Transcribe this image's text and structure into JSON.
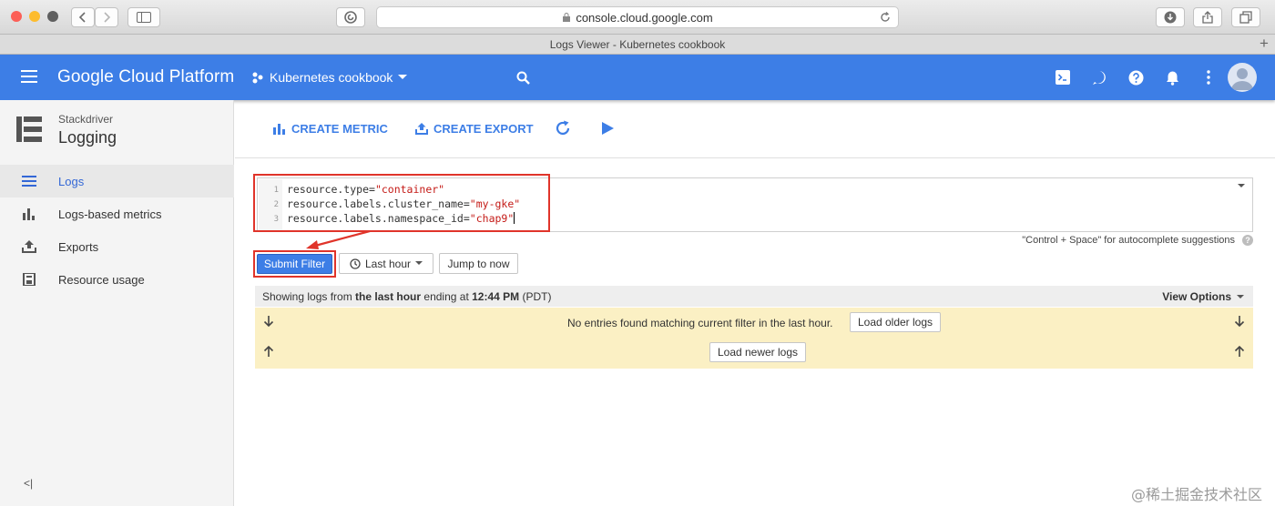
{
  "browser": {
    "url": "console.cloud.google.com",
    "tab_title": "Logs Viewer - Kubernetes cookbook",
    "new_tab": "+"
  },
  "header": {
    "brand": "Google Cloud Platform",
    "project": "Kubernetes cookbook",
    "accent": "#3d7ee6"
  },
  "sidebar": {
    "product_small": "Stackdriver",
    "product_big": "Logging",
    "items": [
      {
        "label": "Logs",
        "icon": "list-icon",
        "active": true
      },
      {
        "label": "Logs-based metrics",
        "icon": "bar-chart-icon"
      },
      {
        "label": "Exports",
        "icon": "upload-icon"
      },
      {
        "label": "Resource usage",
        "icon": "storage-icon"
      }
    ],
    "collapse": "<|"
  },
  "actions": {
    "create_metric": "CREATE METRIC",
    "create_export": "CREATE EXPORT"
  },
  "filter": {
    "lines": [
      {
        "num": "1",
        "key": "resource.type=",
        "value": "\"container\""
      },
      {
        "num": "2",
        "key": "resource.labels.cluster_name=",
        "value": "\"my-gke\""
      },
      {
        "num": "3",
        "key": "resource.labels.namespace_id=",
        "value": "\"chap9\""
      }
    ],
    "hint": "\"Control + Space\" for autocomplete suggestions",
    "help": "?"
  },
  "controls": {
    "submit": "Submit Filter",
    "time_range": "Last hour",
    "jump": "Jump to now"
  },
  "status": {
    "prefix": "Showing logs from ",
    "bold1": "the last hour",
    "middle": " ending at ",
    "bold2": "12:44 PM",
    "suffix": " (PDT)",
    "view_options": "View Options"
  },
  "results": {
    "message": "No entries found matching current filter in the last hour.",
    "load_older": "Load older logs",
    "load_newer": "Load newer logs"
  },
  "watermark": "@稀土掘金技术社区"
}
